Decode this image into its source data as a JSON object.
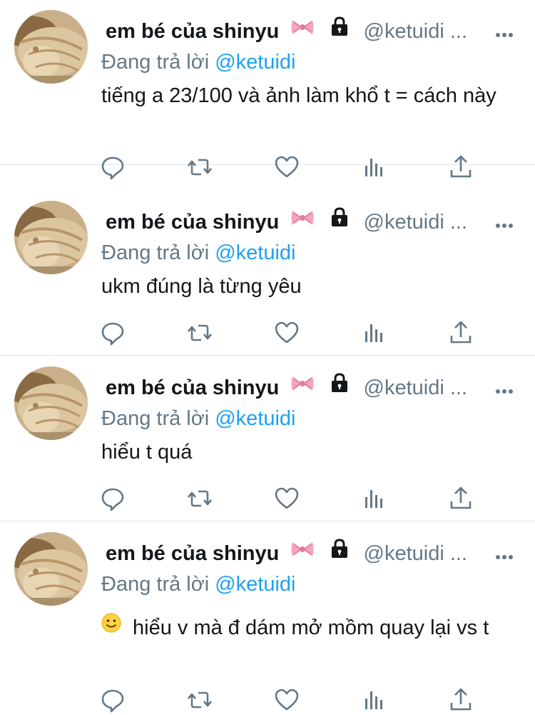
{
  "tweets": [
    {
      "display_name": "em bé của shinyu",
      "handle": "@ketuidi ...",
      "reply_prefix": "Đang trả lời",
      "reply_handle": "@ketuidi",
      "text": "tiếng a 23/100 và ảnh làm khổ t = cách này",
      "emoji_prefix": ""
    },
    {
      "display_name": "em bé của shinyu",
      "handle": "@ketuidi ...",
      "reply_prefix": "Đang trả lời",
      "reply_handle": "@ketuidi",
      "text": "ukm đúng là từng yêu",
      "emoji_prefix": ""
    },
    {
      "display_name": "em bé của shinyu",
      "handle": "@ketuidi ...",
      "reply_prefix": "Đang trả lời",
      "reply_handle": "@ketuidi",
      "text": "hiểu t quá",
      "emoji_prefix": ""
    },
    {
      "display_name": "em bé của shinyu",
      "handle": "@ketuidi ...",
      "reply_prefix": "Đang trả lời",
      "reply_handle": "@ketuidi",
      "text": "hiểu v mà đ dám mở mồm quay lại vs t",
      "emoji_prefix": "slightly-smiling-face"
    }
  ],
  "icons": {
    "name_emoji": "ribbon-bow-icon",
    "protected": "lock-icon",
    "more": "more-dots-icon",
    "reply": "reply-icon",
    "retweet": "retweet-icon",
    "like": "heart-icon",
    "analytics": "analytics-icon",
    "share": "share-icon"
  },
  "colors": {
    "link": "#1da1f2",
    "secondary_text": "#657786",
    "icon": "#657786",
    "divider": "#e1e8ed"
  }
}
